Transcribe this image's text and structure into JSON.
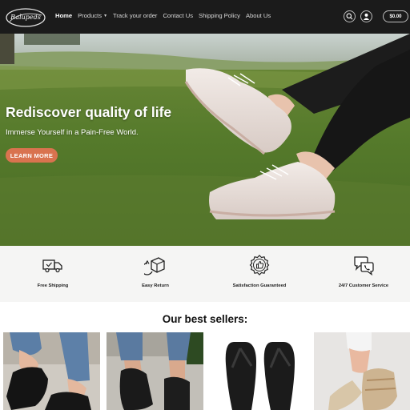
{
  "header": {
    "logo_text": "Ralupeds",
    "nav": [
      {
        "label": "Home",
        "active": true
      },
      {
        "label": "Products",
        "has_dropdown": true
      },
      {
        "label": "Track your order"
      },
      {
        "label": "Contact Us"
      },
      {
        "label": "Shipping Policy"
      },
      {
        "label": "About Us"
      }
    ],
    "icons": [
      "search-icon",
      "account-icon"
    ],
    "cart_total": "$0.00"
  },
  "hero": {
    "title": "Rediscover quality of life",
    "subtitle": "Immerse Yourself in a Pain-Free World.",
    "button_label": "LEARN MORE"
  },
  "features": [
    {
      "icon": "truck-icon",
      "label": "Free Shipping"
    },
    {
      "icon": "return-box-icon",
      "label": "Easy Return"
    },
    {
      "icon": "badge-thumb-icon",
      "label": "Satisfaction Guaranteed"
    },
    {
      "icon": "chat-bubbles-icon",
      "label": "24/7 Customer Service"
    }
  ],
  "best_sellers": {
    "title": "Our best sellers:",
    "products": [
      {
        "image": "black-wedge-sandal-photo"
      },
      {
        "image": "black-loafer-photo"
      },
      {
        "image": "black-flip-flop-photo"
      },
      {
        "image": "beige-sandal-photo"
      }
    ]
  },
  "colors": {
    "header_bg": "#1b1b1b",
    "accent": "#d9734f",
    "features_bg": "#f5f5f4"
  }
}
